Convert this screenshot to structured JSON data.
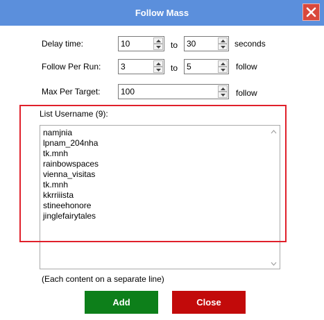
{
  "window": {
    "title": "Follow Mass"
  },
  "delay": {
    "label": "Delay time:",
    "from": "10",
    "to_label": "to",
    "to": "30",
    "unit": "seconds"
  },
  "follow_per_run": {
    "label": "Follow Per Run:",
    "from": "3",
    "to_label": "to",
    "to": "5",
    "unit": "follow"
  },
  "max_per_target": {
    "label": "Max Per Target:",
    "value": "100",
    "unit": "follow"
  },
  "usernames": {
    "label": "List Username (9):",
    "items": [
      "namjnia",
      "lpnam_204nha",
      "tk.mnh",
      "rainbowspaces",
      "vienna_visitas",
      "tk.mnh",
      "kkrriiista",
      "stineehonore",
      "jinglefairytales"
    ],
    "hint": "(Each content on a separate line)"
  },
  "buttons": {
    "add": "Add",
    "close": "Close"
  },
  "colors": {
    "titlebar": "#5b8fdc",
    "add": "#0d7f1a",
    "close": "#c20a0a",
    "highlight": "#e0202a"
  }
}
